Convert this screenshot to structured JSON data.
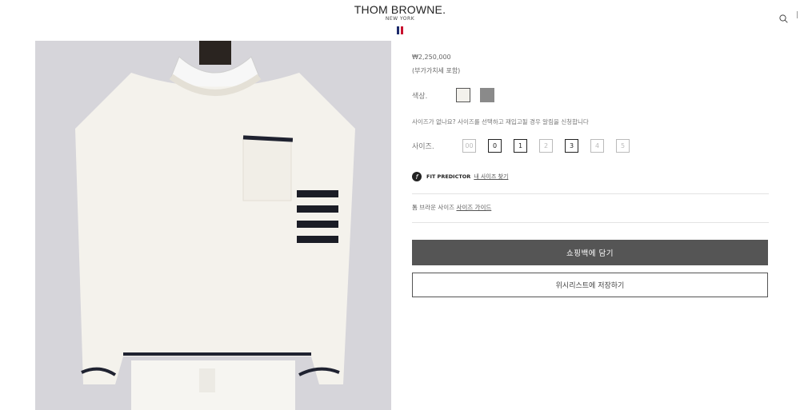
{
  "header": {
    "brand": "THOM BROWNE.",
    "sub": "NEW YORK",
    "flag_colors": [
      "#1d2b6b",
      "#c8102e"
    ],
    "search_icon": "search-icon"
  },
  "product": {
    "image_alt": "white cotton sweater with 4-bar stripes",
    "price": "₩2,250,000",
    "tax_note": "(부가가치세 포함)",
    "color_label": "색상.",
    "colors": [
      {
        "name": "white",
        "hex": "#f3f1ec",
        "selected": true
      },
      {
        "name": "grey",
        "hex": "#8a8a8a",
        "selected": false
      }
    ],
    "size_notice": "사이즈가 없나요? 사이즈를 선택하고 재입고될 경우 알림을 신청합니다",
    "size_label": "사이즈.",
    "sizes": [
      {
        "label": "00",
        "available": false
      },
      {
        "label": "0",
        "available": true
      },
      {
        "label": "1",
        "available": true
      },
      {
        "label": "2",
        "available": false
      },
      {
        "label": "3",
        "available": true
      },
      {
        "label": "4",
        "available": false
      },
      {
        "label": "5",
        "available": false
      }
    ],
    "fit_predictor": "FIT PREDICTOR",
    "fit_link": "내 사이즈 찾기",
    "size_guide_prefix": "톰 브라운 사이즈",
    "size_guide_link": "사이즈 가이드",
    "add_to_bag": "쇼핑백에 담기",
    "add_to_wishlist": "위시리스트에 저장하기"
  }
}
